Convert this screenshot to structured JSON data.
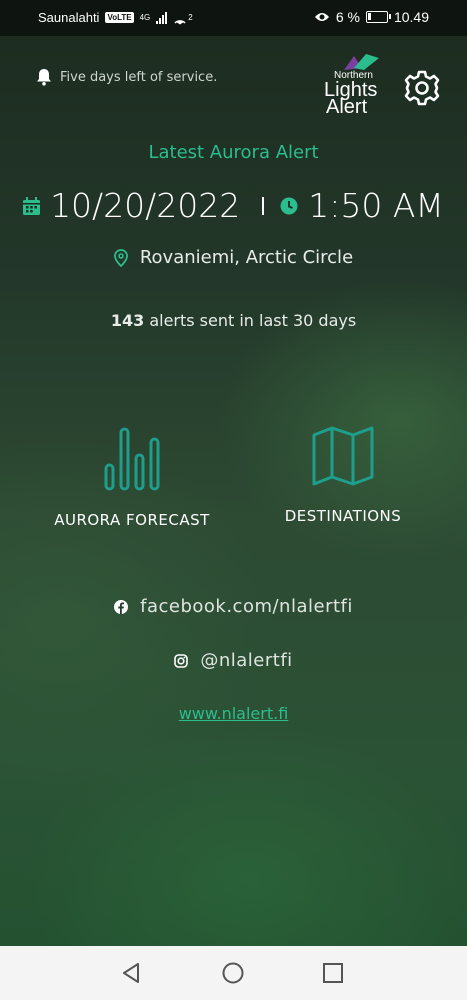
{
  "status_bar": {
    "carrier": "Saunalahti",
    "volte": "VoLTE",
    "network": "4G",
    "hotspot_count": "2",
    "battery": "6 %",
    "time": "10.49"
  },
  "header": {
    "service_notice": "Five days left of service.",
    "logo_lines": [
      "Northern",
      "Lights",
      "Alert"
    ]
  },
  "alert": {
    "heading": "Latest Aurora Alert",
    "date": "10/20/2022",
    "time": "1:50 AM",
    "location": "Rovaniemi, Arctic Circle",
    "count": "143",
    "count_suffix": "alerts sent in last 30 days"
  },
  "nav": {
    "forecast_label": "AURORA FORECAST",
    "destinations_label": "DESTINATIONS"
  },
  "social": {
    "facebook": "facebook.com/nlalertfi",
    "instagram": "@nlalertfi",
    "website": "www.nlalert.fi"
  },
  "colors": {
    "accent": "#2bbd8e",
    "icon_teal": "#1e9e8c",
    "background_dark": "#1c2b1f",
    "background_green": "#2b5235"
  },
  "icons": [
    "bell-icon",
    "settings-gear-icon",
    "calendar-icon",
    "clock-icon",
    "location-pin-icon",
    "bar-chart-icon",
    "map-icon",
    "facebook-icon",
    "instagram-icon",
    "back-icon",
    "home-icon",
    "recent-apps-icon"
  ]
}
